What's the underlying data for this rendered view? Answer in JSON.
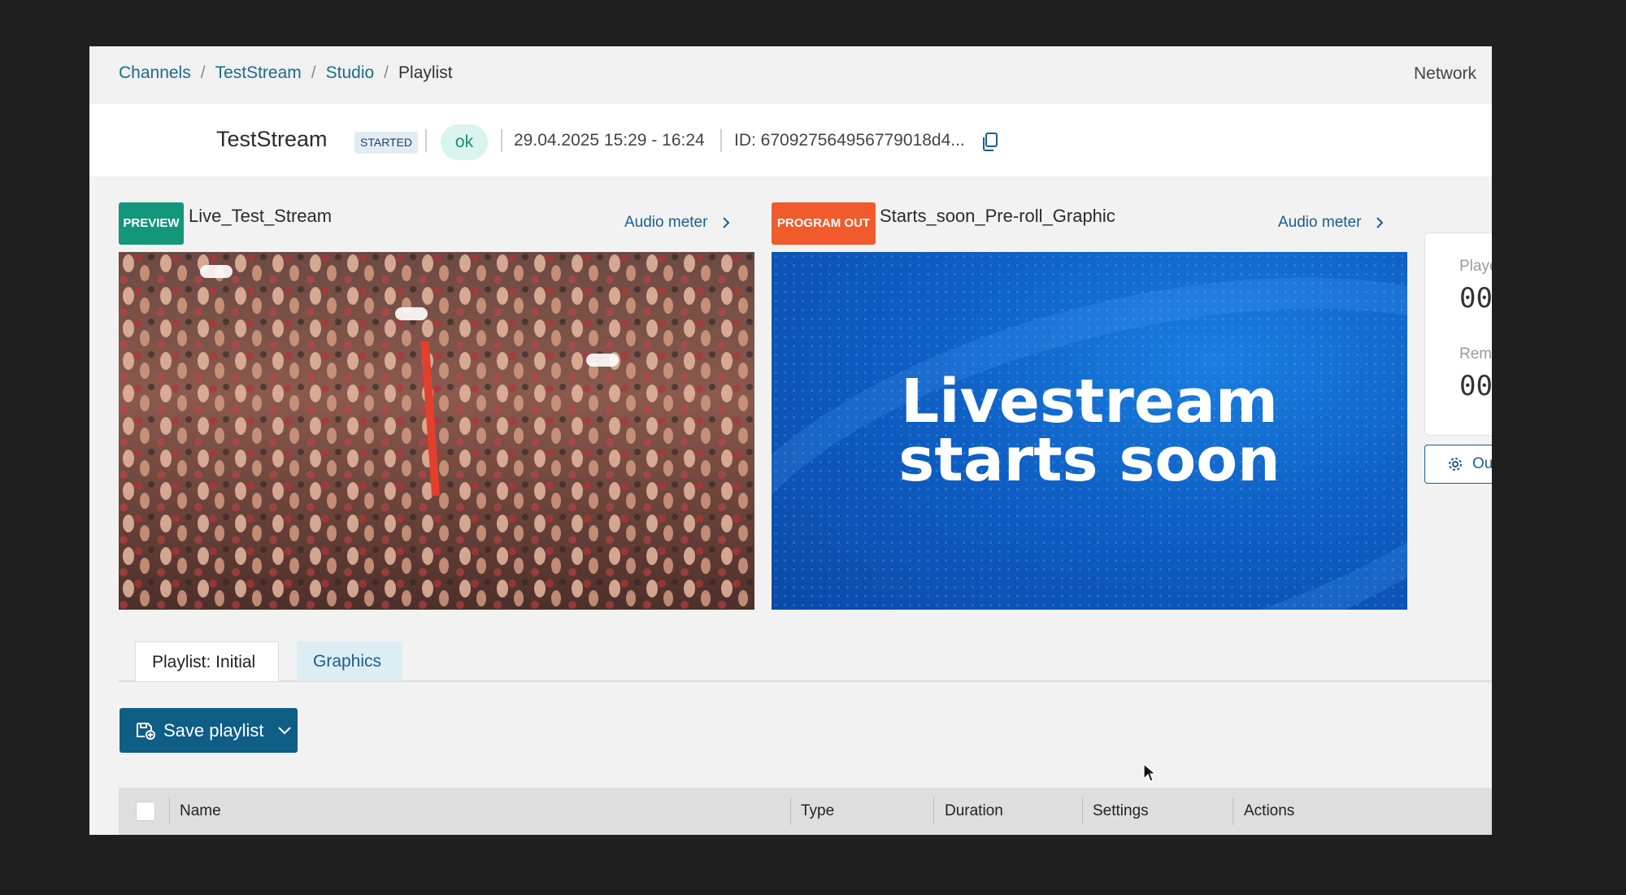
{
  "breadcrumb": {
    "items": [
      "Channels",
      "TestStream",
      "Studio"
    ],
    "current": "Playlist",
    "separator": "/"
  },
  "network_label": "Network",
  "header": {
    "stream_name": "TestStream",
    "status": "STARTED",
    "health": "ok",
    "time_range": "29.04.2025 15:29 - 16:24",
    "id_text": "ID: 670927564956779018d4..."
  },
  "preview": {
    "badge": "PREVIEW",
    "source_name": "Live_Test_Stream",
    "audio_meter": "Audio meter"
  },
  "program": {
    "badge": "PROGRAM OUT",
    "source_name": "Starts_soon_Pre-roll_Graphic",
    "audio_meter": "Audio meter",
    "graphic_line1": "Livestream",
    "graphic_line2": "starts soon"
  },
  "timers": {
    "played_label": "Playe",
    "played_value": "00",
    "remaining_label": "Rema",
    "remaining_value": "00",
    "output_button": "Out"
  },
  "tabs": [
    {
      "label": "Playlist: Initial",
      "active": true
    },
    {
      "label": "Graphics",
      "active": false
    }
  ],
  "save_button": "Save playlist",
  "table": {
    "columns": [
      "Name",
      "Type",
      "Duration",
      "Settings",
      "Actions"
    ]
  },
  "colors": {
    "preview_badge": "#13977a",
    "program_badge": "#f15a2b",
    "primary": "#0f5e86",
    "link": "#1c6b8c"
  }
}
